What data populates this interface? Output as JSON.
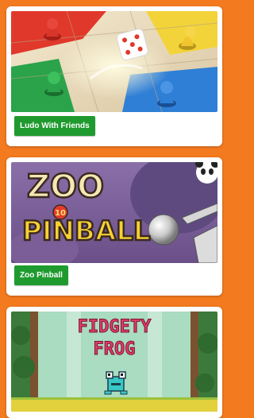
{
  "games": [
    {
      "title": "Ludo With Friends",
      "thumbnail": "ludo-board-thumbnail"
    },
    {
      "title": "Zoo Pinball",
      "thumbnail": "zoo-pinball-thumbnail",
      "logo_text": "ZOO PINBALL",
      "logo_badge": "10"
    },
    {
      "title": "Fidgety Frog",
      "thumbnail": "fidgety-frog-thumbnail",
      "logo_text": "FIDGETY FROG"
    }
  ],
  "colors": {
    "background": "#f47a1f",
    "card": "#ffffff",
    "title_button": "#1f9a2e"
  }
}
